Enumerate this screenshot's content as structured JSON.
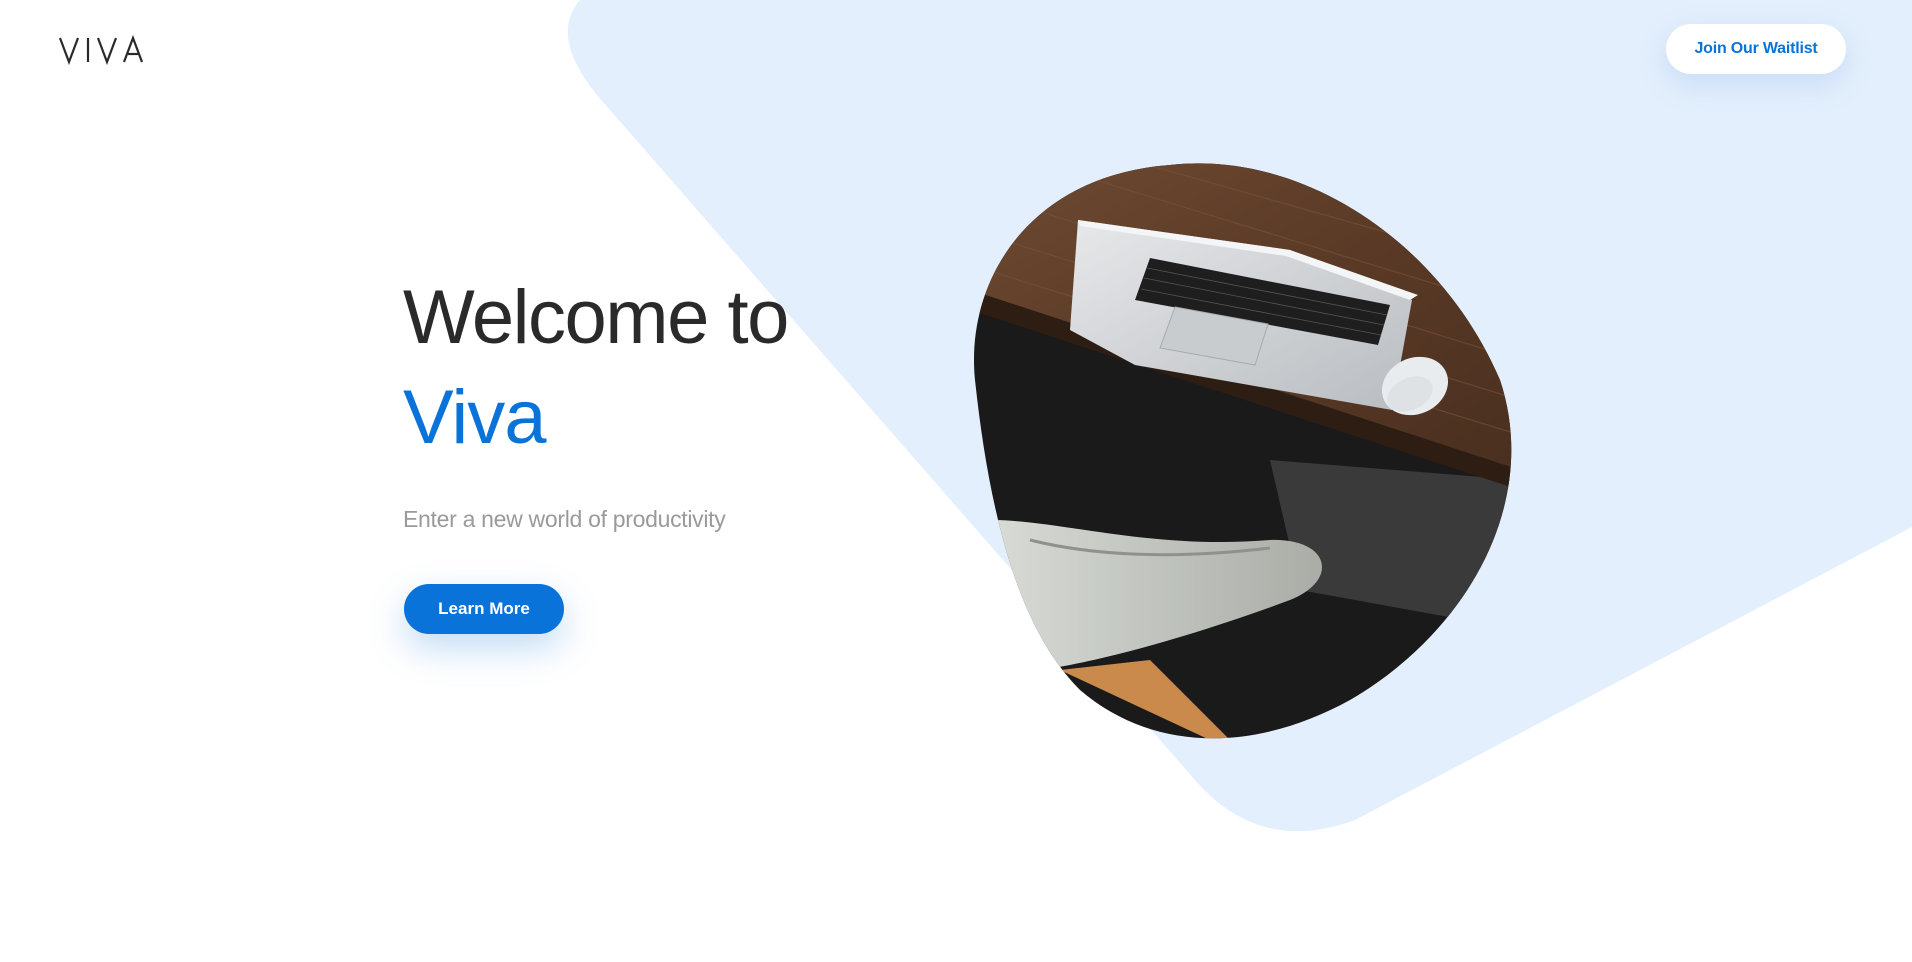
{
  "brand": {
    "logo_text": "VIVA",
    "accent_color": "#0a73d9",
    "background_shape_color": "#e3effc"
  },
  "header": {
    "waitlist_button_label": "Join Our Waitlist"
  },
  "hero": {
    "title_line1": "Welcome to",
    "title_line2": "Viva",
    "subtitle": "Enter a new world of productivity",
    "cta_label": "Learn More"
  },
  "image": {
    "icon": "laptop-desk-photo"
  }
}
